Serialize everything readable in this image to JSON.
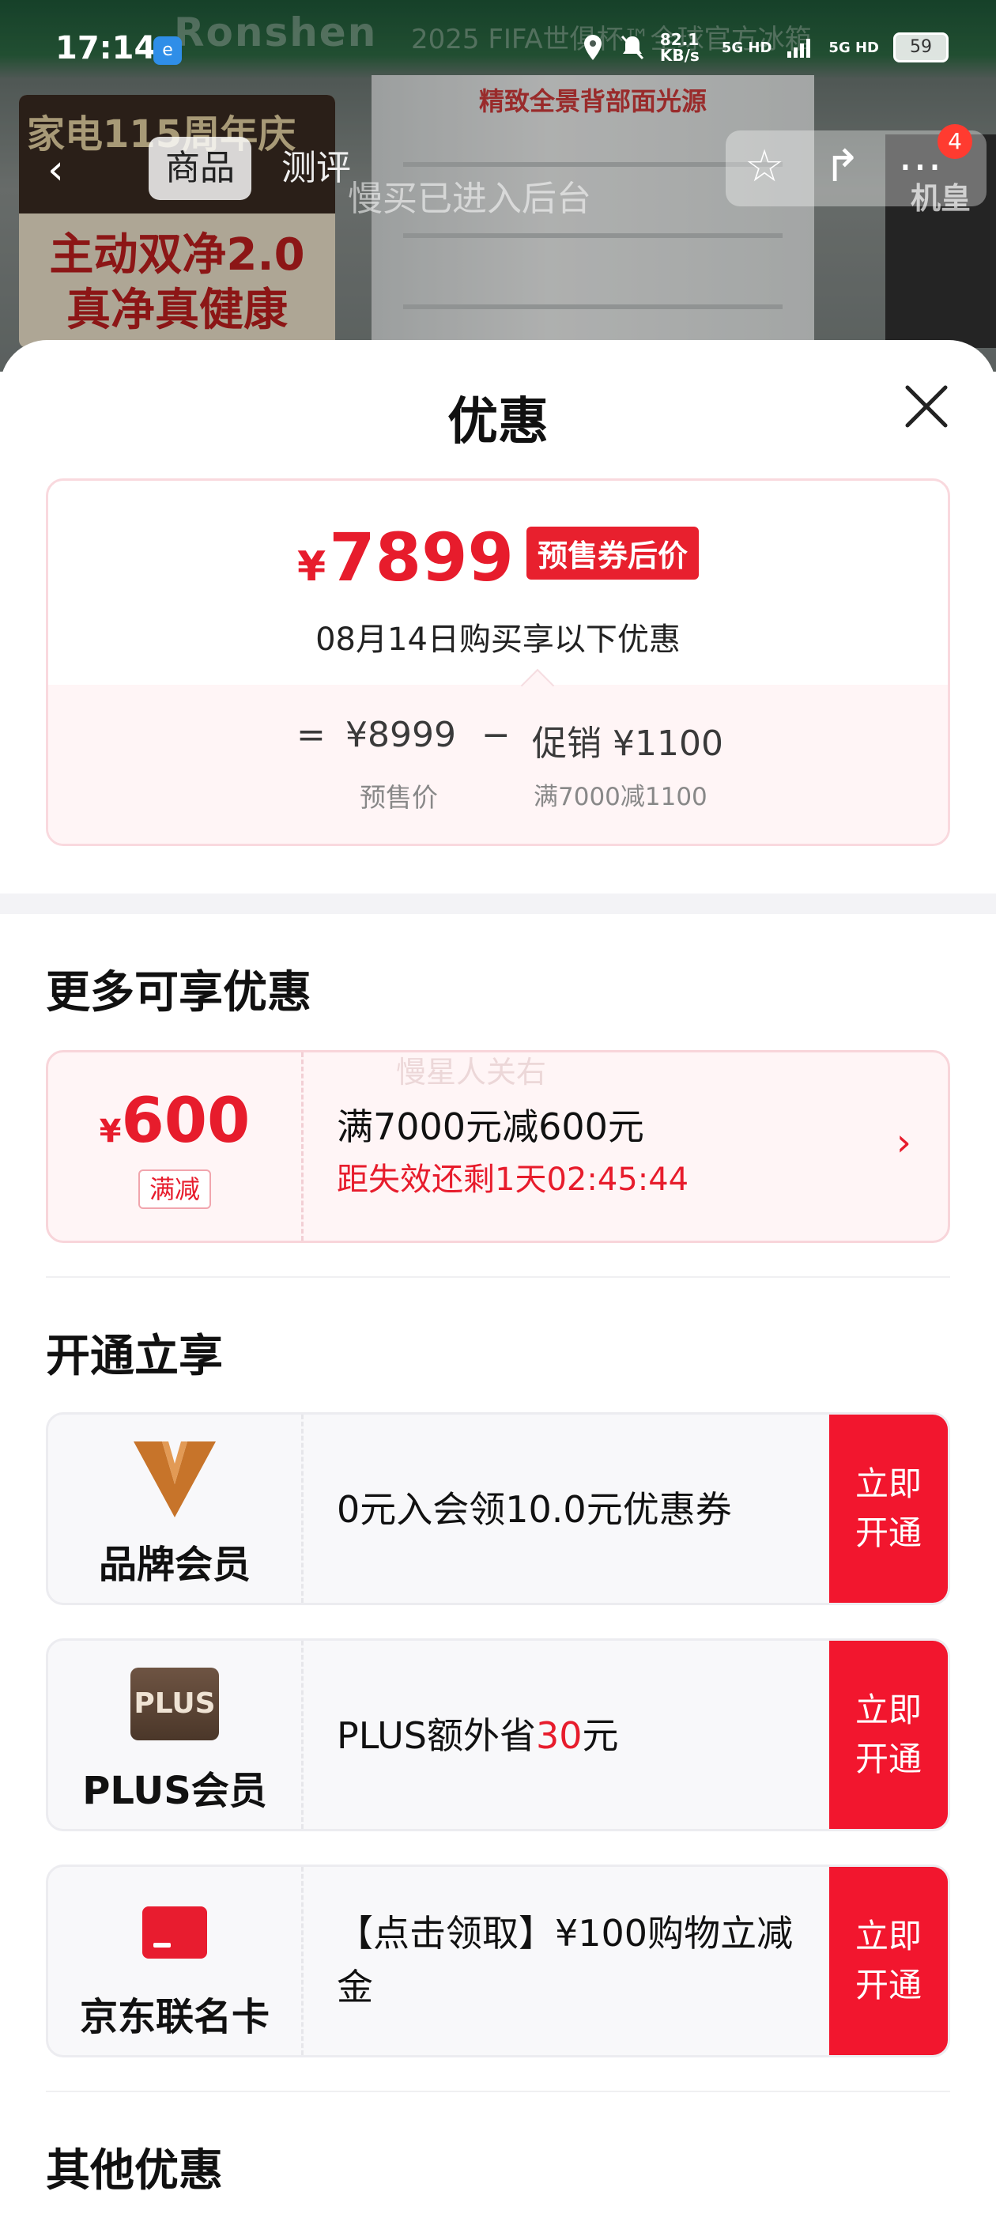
{
  "status_bar": {
    "time": "17:14",
    "app_icon": "e",
    "network_speed": "82.1 KB/s",
    "signal_labels": [
      "5G HD",
      "5G HD"
    ],
    "battery": "59",
    "icons": [
      "location-icon",
      "mute-icon",
      "signal-icon",
      "battery-icon"
    ]
  },
  "hero": {
    "brand_watermark": "Ronshen",
    "fifa_watermark": "2025 FIFA世俱杯™全球官方冰箱",
    "fridge_caption": "精致全景背部面光源",
    "promo_top": "家电115周年庆",
    "promo_line1": "主动双净2.0",
    "promo_line2": "真净真健康",
    "side_badge": "机皇"
  },
  "top_nav": {
    "tab_product": "商品",
    "tab_review": "测评",
    "notice_watermark": "慢买已进入后台",
    "cart_badge": "4"
  },
  "sheet": {
    "title": "优惠",
    "price_card": {
      "currency": "¥",
      "final_price": "7899",
      "price_tag": "预售券后价",
      "purchase_note": "08月14日购买享以下优惠",
      "equals": "=",
      "presale_price": "¥8999",
      "presale_label": "预售价",
      "minus": "−",
      "promo_label_text": "促销 ¥1100",
      "promo_rule": "满7000减1100"
    },
    "more_title": "更多可享优惠",
    "coupon": {
      "currency": "¥",
      "amount": "600",
      "type": "满减",
      "title": "满7000元减600元",
      "countdown": "距失效还剩1天02:45:44",
      "watermark": "慢星人关右"
    },
    "join_title": "开通立享",
    "memberships": [
      {
        "name": "品牌会员",
        "desc": "0元入会领10.0元优惠券",
        "button": "立即 开通"
      },
      {
        "name": "PLUS会员",
        "logo_text": "PLUS",
        "desc_prefix": "PLUS额外省",
        "desc_highlight": "30",
        "desc_suffix": "元",
        "button": "立即 开通"
      },
      {
        "name": "京东联名卡",
        "desc": "【点击领取】¥100购物立减金",
        "button": "立即 开通"
      }
    ],
    "other_title": "其他优惠"
  },
  "colors": {
    "accent_red": "#e71c2c",
    "button_red": "#f2162e",
    "plus_brown": "#5b4333",
    "brand_orange": "#c7742a"
  }
}
